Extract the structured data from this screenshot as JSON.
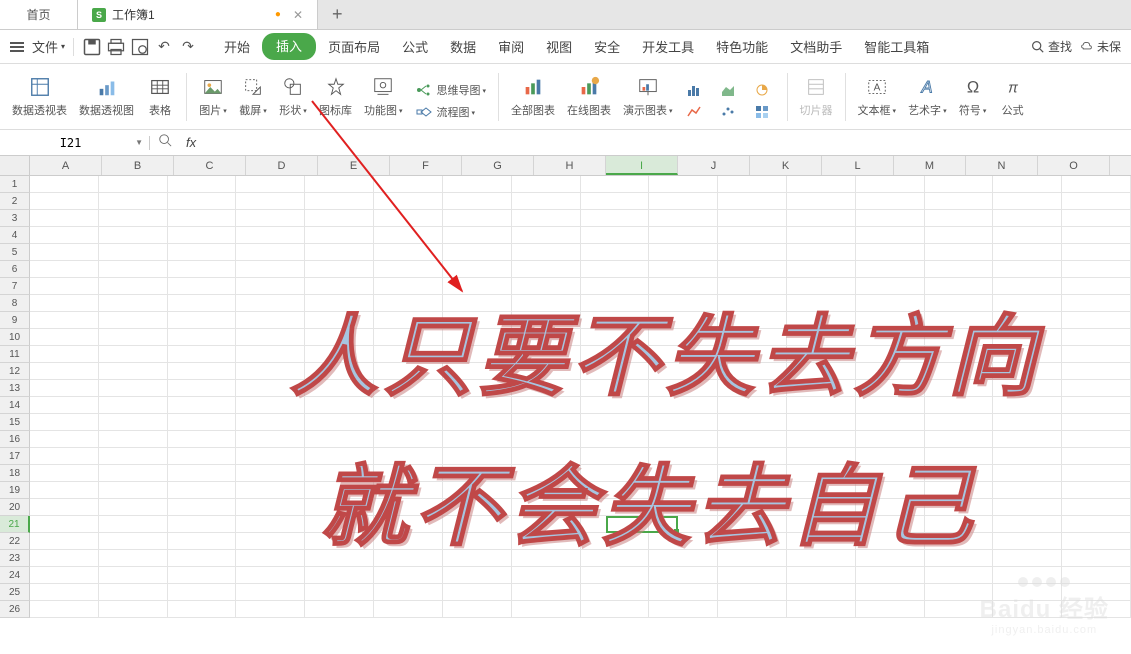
{
  "tabs": {
    "home": "首页",
    "doc": "工作簿1",
    "add": "+"
  },
  "menu": {
    "file": "文件",
    "mtabs": [
      "开始",
      "插入",
      "页面布局",
      "公式",
      "数据",
      "审阅",
      "视图",
      "安全",
      "开发工具",
      "特色功能",
      "文档助手",
      "智能工具箱"
    ],
    "search": "查找",
    "unsaved": "未保"
  },
  "ribbon": {
    "pivottable": "数据透视表",
    "pivotview": "数据透视图",
    "table": "表格",
    "picture": "图片",
    "screenshot": "截屏",
    "shape": "形状",
    "iconlib": "图标库",
    "funcimg": "功能图",
    "mindmap": "思维导图",
    "flowchart": "流程图",
    "allchart": "全部图表",
    "onlinechart": "在线图表",
    "presentchart": "演示图表",
    "slicer": "切片器",
    "textbox": "文本框",
    "wordart": "艺术字",
    "symbol": "符号",
    "equation": "公式"
  },
  "namebox": "I21",
  "columns": [
    "A",
    "B",
    "C",
    "D",
    "E",
    "F",
    "G",
    "H",
    "I",
    "J",
    "K",
    "L",
    "M",
    "N",
    "O"
  ],
  "rows": [
    1,
    2,
    3,
    4,
    5,
    6,
    7,
    8,
    9,
    10,
    11,
    12,
    13,
    14,
    15,
    16,
    17,
    18,
    19,
    20,
    21,
    22,
    23,
    24,
    25,
    26
  ],
  "selected": {
    "col": "I",
    "row": 21
  },
  "wordart_line1": "人只要不失去方向",
  "wordart_line2": "就不会失去自己",
  "watermark": {
    "brand": "Baidu 经验",
    "url": "jingyan.baidu.com"
  }
}
